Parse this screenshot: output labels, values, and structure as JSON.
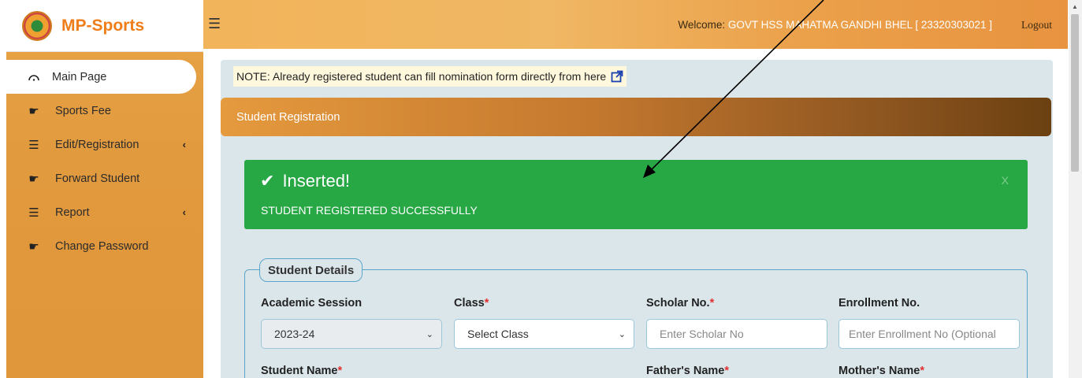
{
  "brand": {
    "name": "MP-Sports"
  },
  "sidebar": {
    "items": [
      {
        "label": "Main Page",
        "icon": "dashboard-gauge-icon",
        "active": true,
        "has_submenu": false
      },
      {
        "label": "Sports Fee",
        "icon": "hand-pointer-icon",
        "active": false,
        "has_submenu": false
      },
      {
        "label": "Edit/Registration",
        "icon": "list-icon",
        "active": false,
        "has_submenu": true
      },
      {
        "label": "Forward Student",
        "icon": "hand-pointer-icon",
        "active": false,
        "has_submenu": false
      },
      {
        "label": "Report",
        "icon": "list-icon",
        "active": false,
        "has_submenu": true
      },
      {
        "label": "Change Password",
        "icon": "hand-pointer-icon",
        "active": false,
        "has_submenu": false
      }
    ]
  },
  "header": {
    "welcome_label": "Welcome: ",
    "school": "GOVT HSS MAHATMA GANDHI BHEL [ 23320303021 ]",
    "logout": "Logout"
  },
  "note": {
    "text": "NOTE: Already registered student can fill nomination form directly from here"
  },
  "panel": {
    "title": "Student Registration"
  },
  "alert": {
    "title": "Inserted!",
    "message": "STUDENT REGISTERED SUCCESSFULLY",
    "close": "X"
  },
  "form": {
    "legend": "Student Details",
    "academic_session": {
      "label": "Academic Session",
      "value": "2023-24"
    },
    "class": {
      "label": "Class",
      "value": "Select Class"
    },
    "scholar_no": {
      "label": "Scholar No.",
      "placeholder": "Enter Scholar No"
    },
    "enrollment_no": {
      "label": "Enrollment No.",
      "placeholder": "Enter Enrollment No (Optional"
    },
    "student_name": {
      "label": "Student Name"
    },
    "father_name": {
      "label": "Father's Name"
    },
    "mother_name": {
      "label": "Mother's Name"
    },
    "required_marker": "*"
  },
  "colors": {
    "sidebar": "#e29a3e",
    "brand_text": "#ef7d1a",
    "alert_success": "#28a745",
    "content_bg": "#dbe6ea",
    "required": "#e03030"
  }
}
